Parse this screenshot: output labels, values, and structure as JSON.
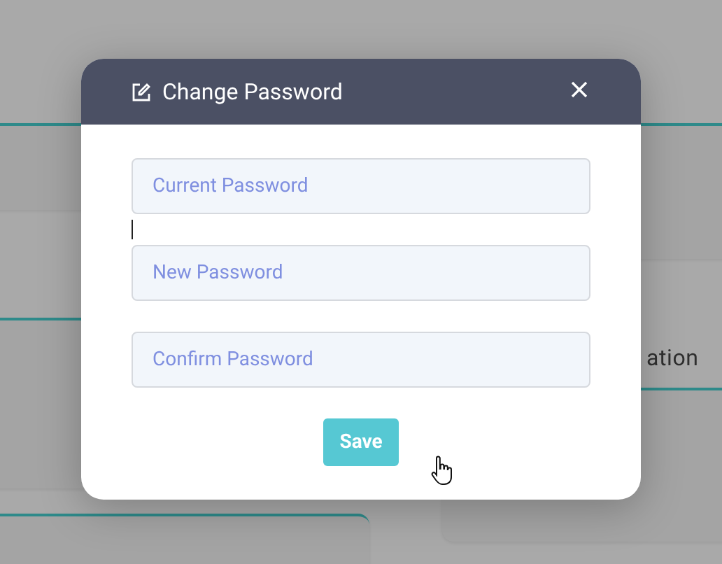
{
  "background": {
    "label": "ation"
  },
  "dialog": {
    "title": "Change Password",
    "fields": [
      {
        "placeholder": "Current Password"
      },
      {
        "placeholder": "New Password"
      },
      {
        "placeholder": "Confirm Password"
      }
    ],
    "button": "Save"
  }
}
